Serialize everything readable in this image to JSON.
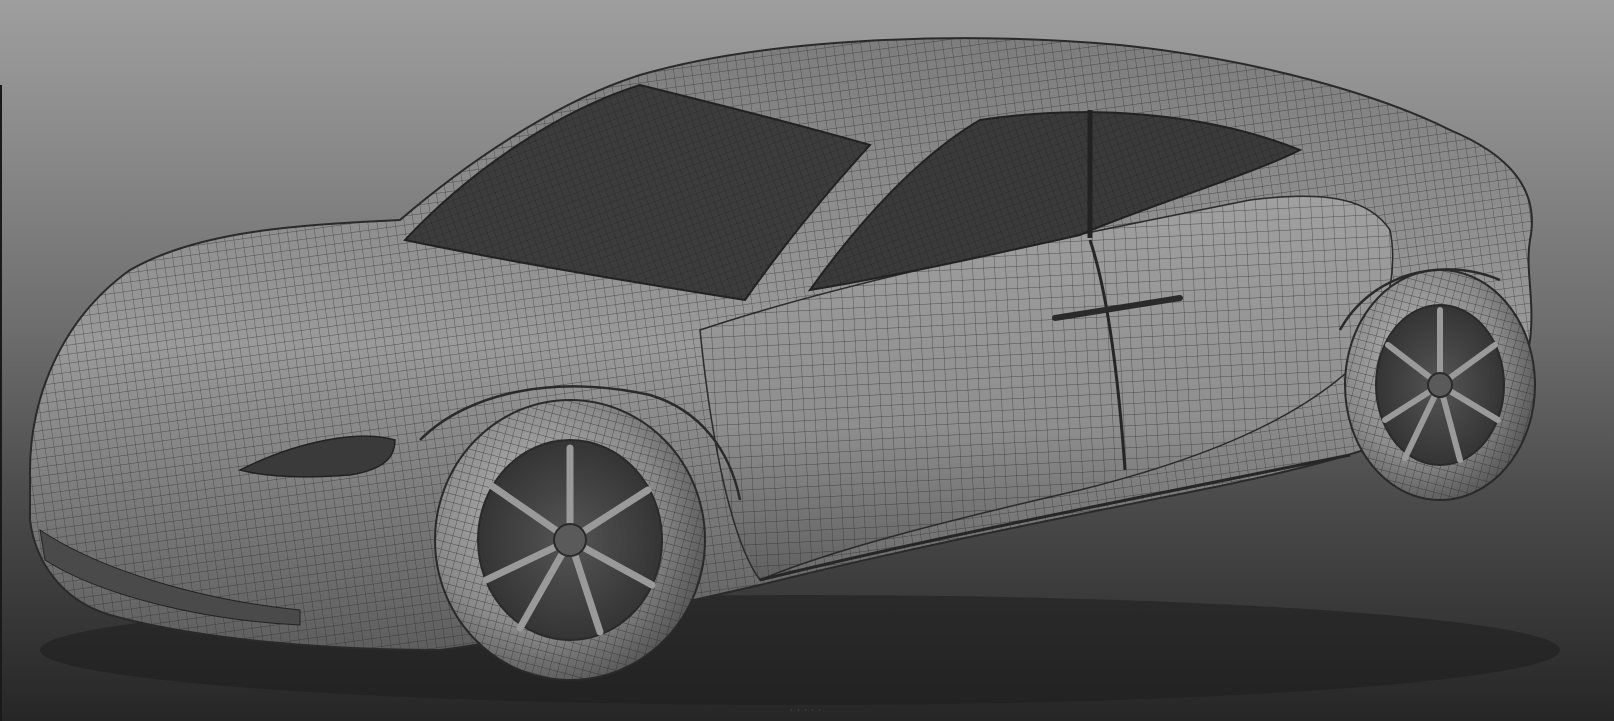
{
  "scene": {
    "subject": "car-wireframe-model",
    "background_top": "#9e9e9e",
    "background_bottom": "#262626",
    "body_color": "#8c8c8c",
    "glass_color": "#3c3c3c",
    "tire_color": "#6a6a6a",
    "wire_color": "#2e2e2e"
  }
}
